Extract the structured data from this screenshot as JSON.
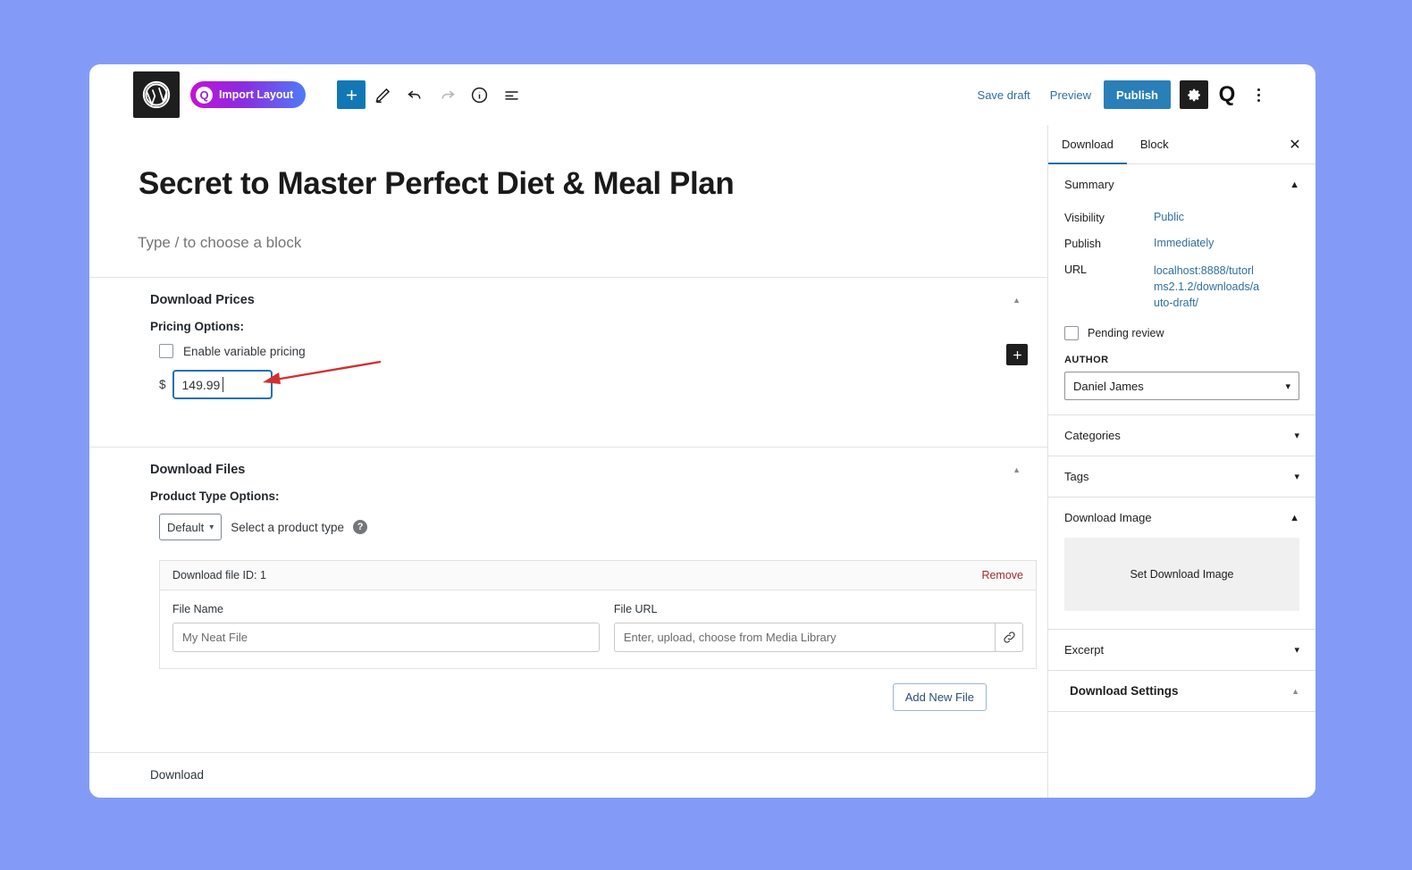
{
  "toolbar": {
    "wordpress_icon": "wordpress-logo-icon",
    "import_layout_label": "Import Layout",
    "import_badge": "Q",
    "add_block_icon": "plus-icon",
    "edit_icon": "pencil-icon",
    "undo_icon": "undo-icon",
    "redo_icon": "redo-icon",
    "info_icon": "info-icon",
    "list_view_icon": "list-view-icon",
    "save_draft_label": "Save draft",
    "preview_label": "Preview",
    "publish_label": "Publish",
    "settings_icon": "gear-icon",
    "q_icon": "Q",
    "options_icon": "kebab-menu-icon",
    "accent_publish": "#2a7fb8"
  },
  "editor": {
    "post_title": "Secret to Master Perfect Diet & Meal Plan",
    "block_placeholder": "Type / to choose a block",
    "inserter_icon": "plus-icon",
    "prices": {
      "section_title": "Download Prices",
      "collapse_icon": "triangle-up-icon",
      "pricing_options_label": "Pricing Options:",
      "variable_pricing_label": "Enable variable pricing",
      "variable_pricing_checked": false,
      "currency_symbol": "$",
      "price_value": "149.99",
      "annotation": "red-arrow-pointing-to-price"
    },
    "files": {
      "section_title": "Download Files",
      "collapse_icon": "triangle-up-icon",
      "product_type_label": "Product Type Options:",
      "product_type_value": "Default",
      "product_type_helper": "Select a product type",
      "help_icon": "question-mark-icon",
      "file_row": {
        "header": "Download file ID: 1",
        "remove_label": "Remove",
        "file_name_label": "File Name",
        "file_name_placeholder": "My Neat File",
        "file_name_value": "",
        "file_url_label": "File URL",
        "file_url_placeholder": "Enter, upload, choose from Media Library",
        "file_url_value": "",
        "link_icon": "chain-link-icon"
      },
      "add_new_file_label": "Add New File"
    },
    "bottom_meta_label": "Download"
  },
  "sidebar": {
    "tabs": [
      {
        "label": "Download",
        "active": true
      },
      {
        "label": "Block",
        "active": false
      }
    ],
    "close_icon": "close-icon",
    "summary": {
      "title": "Summary",
      "chevron": "chevron-up-icon",
      "rows": [
        {
          "key": "Visibility",
          "value": "Public"
        },
        {
          "key": "Publish",
          "value": "Immediately"
        },
        {
          "key": "URL",
          "value": "localhost:8888/tutorlms2.1.2/downloads/auto-draft/"
        }
      ],
      "pending_review_label": "Pending review",
      "pending_review_checked": false,
      "author_label": "AUTHOR",
      "author_value": "Daniel James",
      "author_chevron": "chevron-down-icon"
    },
    "panels": [
      {
        "title": "Categories",
        "chevron": "chevron-down-icon"
      },
      {
        "title": "Tags",
        "chevron": "chevron-down-icon"
      }
    ],
    "download_image": {
      "title": "Download Image",
      "chevron": "chevron-up-icon",
      "placeholder_label": "Set Download Image"
    },
    "excerpt": {
      "title": "Excerpt",
      "chevron": "chevron-down-icon"
    },
    "download_settings": {
      "title": "Download Settings",
      "chevron": "triangle-up-icon"
    }
  }
}
